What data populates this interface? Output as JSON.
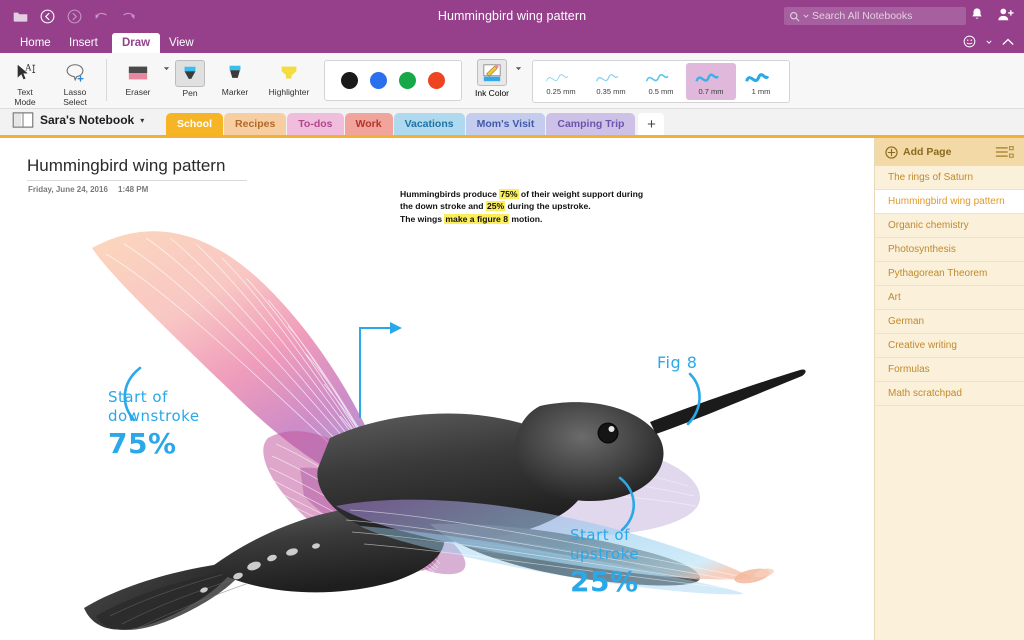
{
  "titlebar": {
    "document_title": "Hummingbird wing pattern",
    "search_placeholder": "Search All Notebooks",
    "icons": [
      "folder-icon",
      "back-icon",
      "forward-icon",
      "undo-icon",
      "redo-icon",
      "notifications-bell-icon",
      "share-person-icon",
      "feedback-smiley-icon",
      "collapse-ribbon-icon"
    ],
    "accent_color": "#96408c"
  },
  "ribbon": {
    "tabs": [
      {
        "label": "Home",
        "active": false
      },
      {
        "label": "Insert",
        "active": false
      },
      {
        "label": "Draw",
        "active": true
      },
      {
        "label": "View",
        "active": false
      }
    ]
  },
  "toolbar": {
    "tools": [
      {
        "label_line1": "Text",
        "label_line2": "Mode",
        "name": "text-mode"
      },
      {
        "label_line1": "Lasso",
        "label_line2": "Select",
        "name": "lasso-select"
      },
      {
        "label_line1": "Eraser",
        "label_line2": "",
        "name": "eraser"
      },
      {
        "label_line1": "Pen",
        "label_line2": "",
        "name": "pen",
        "selected": true
      },
      {
        "label_line1": "Marker",
        "label_line2": "",
        "name": "marker"
      },
      {
        "label_line1": "Highlighter",
        "label_line2": "",
        "name": "highlighter"
      }
    ],
    "colors": [
      {
        "name": "black",
        "hex": "#1a1a1a"
      },
      {
        "name": "blue",
        "hex": "#2a6ff0"
      },
      {
        "name": "green",
        "hex": "#17a849"
      },
      {
        "name": "red",
        "hex": "#ee4422"
      }
    ],
    "ink_color_label": "Ink Color",
    "thicknesses": [
      {
        "label": "0.25 mm",
        "stroke": 1.0,
        "selected": false
      },
      {
        "label": "0.35 mm",
        "stroke": 1.4,
        "selected": false
      },
      {
        "label": "0.5 mm",
        "stroke": 1.9,
        "selected": false
      },
      {
        "label": "0.7 mm",
        "stroke": 2.8,
        "selected": true
      },
      {
        "label": "1 mm",
        "stroke": 3.6,
        "selected": false
      }
    ],
    "selected_thickness": "0.7 mm"
  },
  "notebook": {
    "name": "Sara's Notebook",
    "sections": [
      {
        "label": "School",
        "bg": "#f5b526",
        "fg": "#ffffff",
        "active": true
      },
      {
        "label": "Recipes",
        "bg": "#f7cda2",
        "fg": "#b06a2a",
        "active": false
      },
      {
        "label": "To-dos",
        "bg": "#f0bedc",
        "fg": "#b0478e",
        "active": false
      },
      {
        "label": "Work",
        "bg": "#f0a49c",
        "fg": "#b5342c",
        "active": false
      },
      {
        "label": "Vacations",
        "bg": "#aed9ee",
        "fg": "#2173a4",
        "active": false
      },
      {
        "label": "Mom's Visit",
        "bg": "#c4cdee",
        "fg": "#4558a8",
        "active": false
      },
      {
        "label": "Camping Trip",
        "bg": "#cdc1e8",
        "fg": "#6a55a8",
        "active": false
      }
    ],
    "add_section_label": "+"
  },
  "page": {
    "title": "Hummingbird wing pattern",
    "date": "Friday, June 24, 2016",
    "time": "1:48 PM",
    "note": {
      "line1_a": "Hummingbirds produce ",
      "line1_hl": "75%",
      "line1_b": " of their weight support during",
      "line2_a": "the down stroke and ",
      "line2_hl": "25%",
      "line2_b": " during the upstroke.",
      "line3_a": "The wings ",
      "line3_hl": "make a figure 8",
      "line3_b": " motion."
    },
    "annotations": {
      "downstroke": {
        "line1": "Start of",
        "line2": "downstroke",
        "percent": "75%"
      },
      "upstroke": {
        "line1": "Start of",
        "line2": "upstroke",
        "percent": "25%"
      },
      "fig8": "Fig 8"
    },
    "ink_color": "#2aa8e8"
  },
  "sidebar": {
    "add_page_label": "Add Page",
    "pages": [
      {
        "label": "The rings of Saturn",
        "selected": false
      },
      {
        "label": "Hummingbird wing pattern",
        "selected": true
      },
      {
        "label": "Organic chemistry",
        "selected": false
      },
      {
        "label": "Photosynthesis",
        "selected": false
      },
      {
        "label": "Pythagorean Theorem",
        "selected": false
      },
      {
        "label": "Art",
        "selected": false
      },
      {
        "label": "German",
        "selected": false
      },
      {
        "label": "Creative writing",
        "selected": false
      },
      {
        "label": "Formulas",
        "selected": false
      },
      {
        "label": "Math scratchpad",
        "selected": false
      }
    ]
  }
}
